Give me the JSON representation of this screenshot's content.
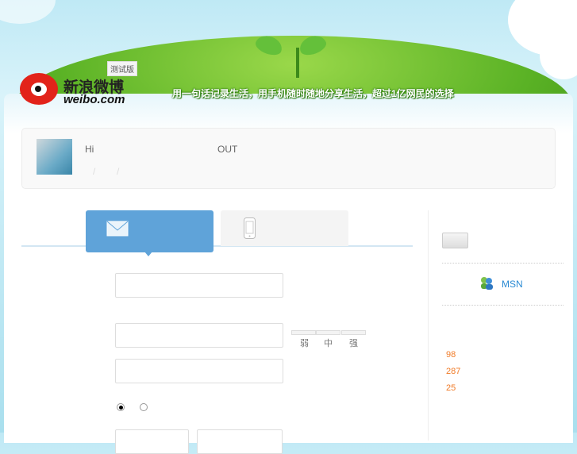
{
  "header": {
    "logo_text": "新浪微博",
    "logo_domain": "weibo.com",
    "beta_badge": "测试版",
    "slogan": "用一句话记录生活，用手机随时随地分享生活，超过1亿网民的选择"
  },
  "user": {
    "greeting": "Hi",
    "logout": "OUT",
    "separators": [
      "/",
      "/"
    ]
  },
  "tabs": [
    {
      "icon": "envelope-icon",
      "active": true
    },
    {
      "icon": "phone-icon",
      "active": false
    }
  ],
  "form": {
    "strength_labels": [
      "弱",
      "中",
      "强"
    ]
  },
  "sidebar": {
    "msn_label": "MSN",
    "stats": [
      "98",
      "287",
      "25"
    ]
  },
  "colors": {
    "accent": "#5fa3d9",
    "stat": "#f07a26"
  }
}
